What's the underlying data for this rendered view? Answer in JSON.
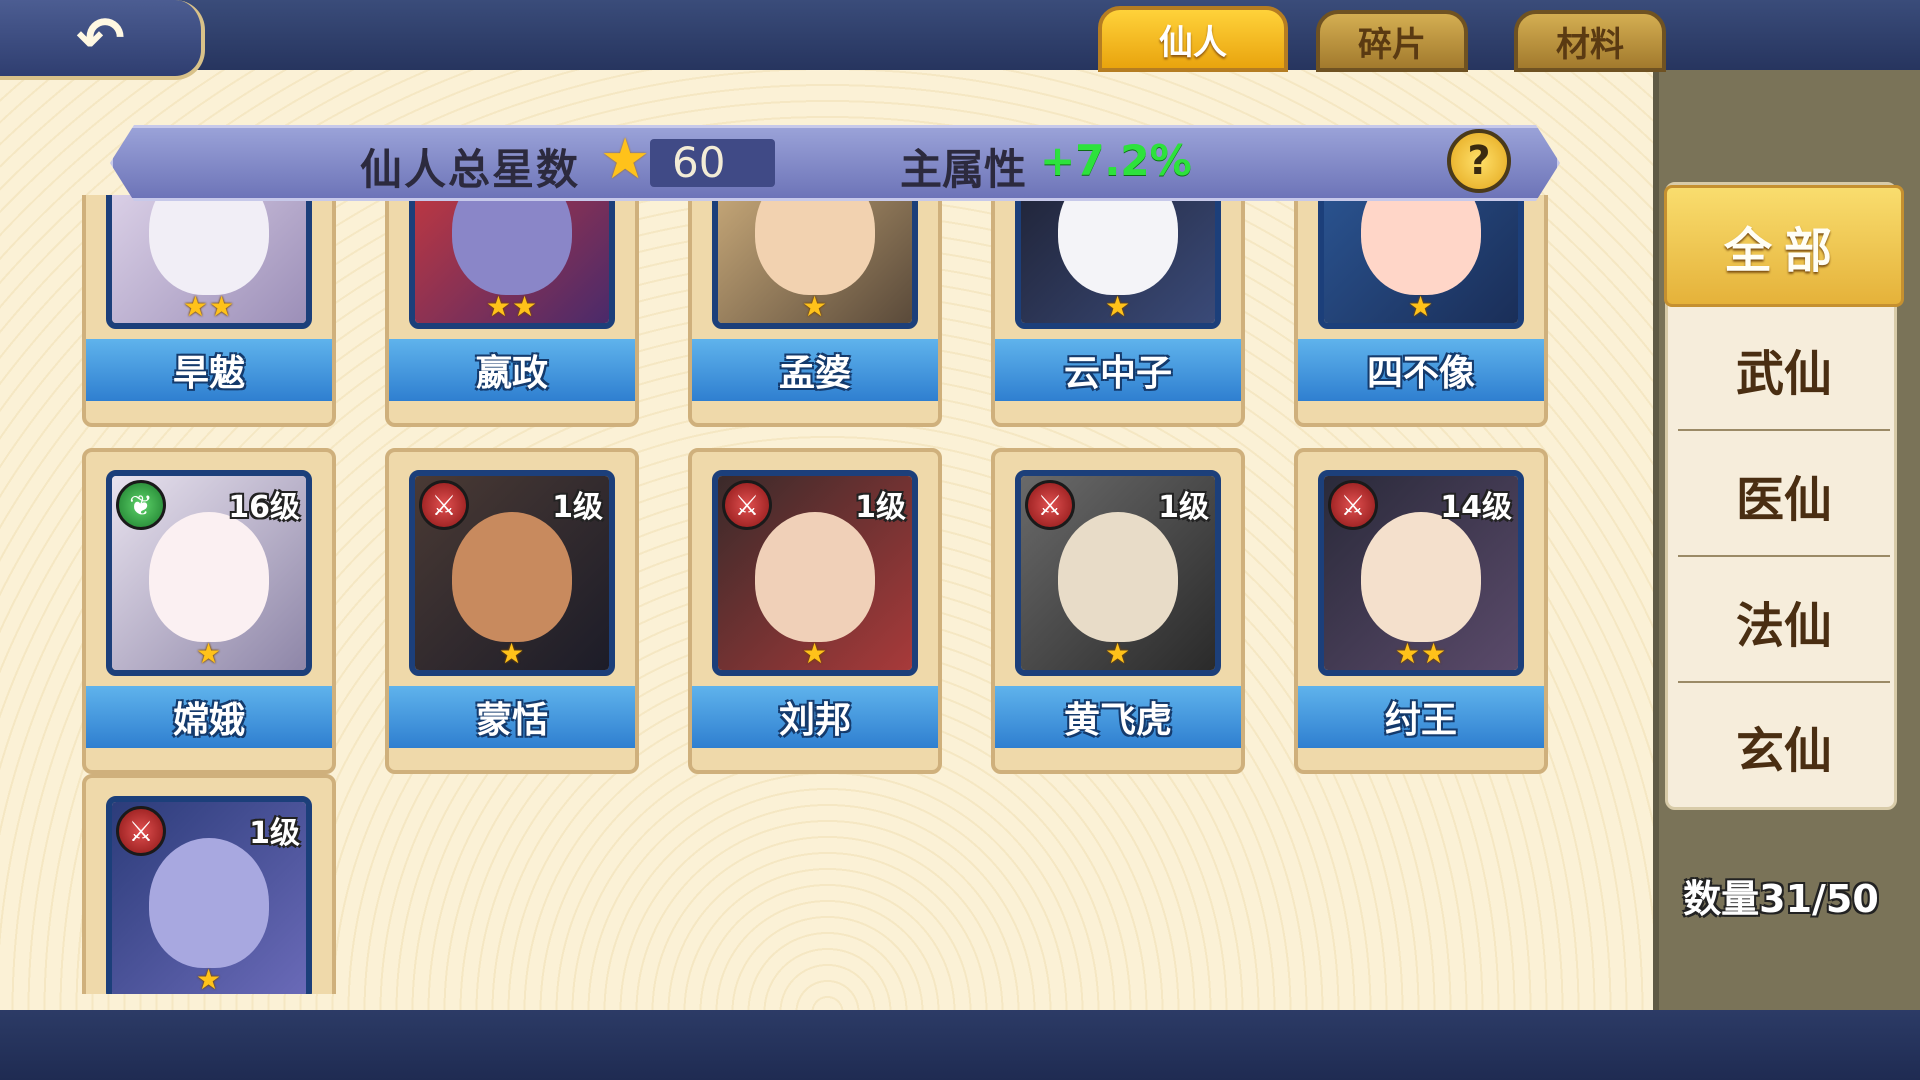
{
  "nav": {
    "back_icon": "back-arrow-icon",
    "back_glyph": "↶"
  },
  "tabs": [
    {
      "label": "仙人",
      "active": true
    },
    {
      "label": "碎片",
      "active": false
    },
    {
      "label": "材料",
      "active": false
    }
  ],
  "banner": {
    "star_total_label": "仙人总星数",
    "star_icon": "star-icon",
    "star_total": "60",
    "main_attr_label": "主属性",
    "main_attr_bonus": "+7.2%",
    "help_glyph": "?"
  },
  "heroes": [
    {
      "name": "旱魃",
      "stars": "★★",
      "level": "",
      "element": "",
      "element_glyph": ""
    },
    {
      "name": "嬴政",
      "stars": "★★",
      "level": "",
      "element": "",
      "element_glyph": ""
    },
    {
      "name": "孟婆",
      "stars": "★",
      "level": "",
      "element": "",
      "element_glyph": ""
    },
    {
      "name": "云中子",
      "stars": "★",
      "level": "",
      "element": "",
      "element_glyph": ""
    },
    {
      "name": "四不像",
      "stars": "★",
      "level": "",
      "element": "",
      "element_glyph": ""
    },
    {
      "name": "嫦娥",
      "stars": "★",
      "level": "16级",
      "element": "leaf",
      "element_glyph": "❦"
    },
    {
      "name": "蒙恬",
      "stars": "★",
      "level": "1级",
      "element": "sword",
      "element_glyph": "⚔"
    },
    {
      "name": "刘邦",
      "stars": "★",
      "level": "1级",
      "element": "sword",
      "element_glyph": "⚔"
    },
    {
      "name": "黄飞虎",
      "stars": "★",
      "level": "1级",
      "element": "sword",
      "element_glyph": "⚔"
    },
    {
      "name": "纣王",
      "stars": "★★",
      "level": "14级",
      "element": "sword",
      "element_glyph": "⚔"
    },
    {
      "name": "",
      "stars": "★",
      "level": "1级",
      "element": "sword",
      "element_glyph": "⚔"
    }
  ],
  "categories": [
    {
      "label": "全部",
      "active": true
    },
    {
      "label": "武仙",
      "active": false
    },
    {
      "label": "医仙",
      "active": false
    },
    {
      "label": "法仙",
      "active": false
    },
    {
      "label": "玄仙",
      "active": false
    }
  ],
  "count_text": "数量31/50",
  "colors": {
    "tab_active": "#f2b620",
    "namebar": "#3a8ad6",
    "bonus_green": "#2de23c",
    "category_active": "#efc24c"
  }
}
